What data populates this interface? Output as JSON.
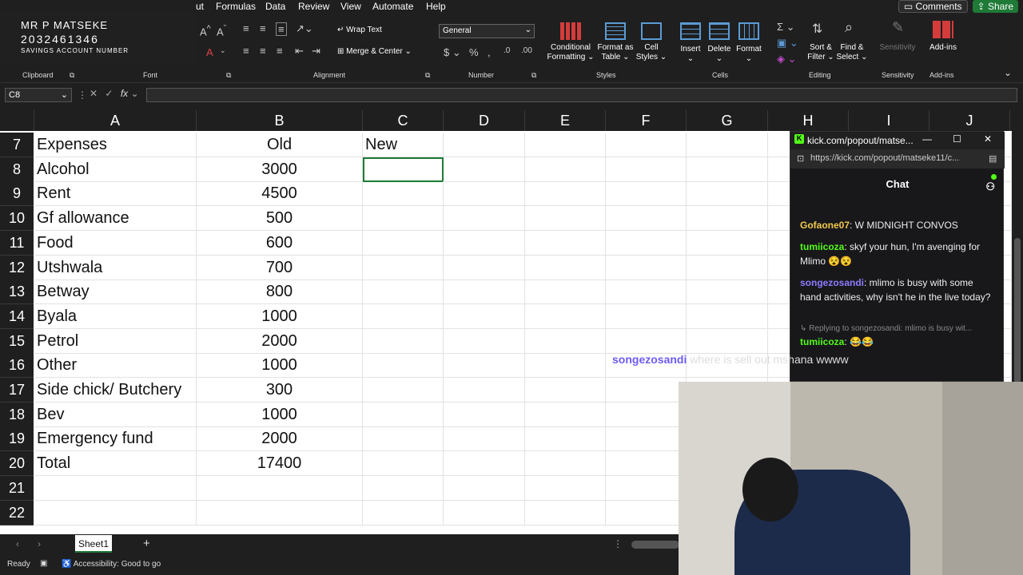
{
  "menu": {
    "tabs": [
      "ut",
      "Formulas",
      "Data",
      "Review",
      "View",
      "Automate",
      "Help"
    ],
    "comments_label": "Comments",
    "share_label": "Share"
  },
  "overlay": {
    "name": "MR P MATSEKE",
    "number": "2032461346",
    "label": "SAVINGS ACCOUNT NUMBER"
  },
  "ribbon": {
    "groups": {
      "clipboard": "Clipboard",
      "font": "Font",
      "alignment": "Alignment",
      "number": "Number",
      "styles": "Styles",
      "cells": "Cells",
      "editing": "Editing",
      "sensitivity": "Sensitivity",
      "addins": "Add-ins"
    },
    "wrap_text": "Wrap Text",
    "merge_center": "Merge & Center",
    "number_format": "General",
    "conditional_formatting": "Conditional Formatting",
    "format_as_table": "Format as Table",
    "cell_styles": "Cell Styles",
    "insert": "Insert",
    "delete": "Delete",
    "format": "Format",
    "sort_filter": "Sort & Filter",
    "find_select": "Find & Select",
    "sensitivity_btn": "Sensitivity",
    "addins_btn": "Add-ins"
  },
  "formula_bar": {
    "name_box": "C8",
    "fx": "fx",
    "value": ""
  },
  "grid": {
    "columns": [
      "A",
      "B",
      "C",
      "D",
      "E",
      "F",
      "G",
      "H",
      "I",
      "J"
    ],
    "rows": [
      {
        "num": "7",
        "a": "Expenses",
        "b": "Old",
        "c": "New"
      },
      {
        "num": "8",
        "a": "Alcohol",
        "b": "3000",
        "c": ""
      },
      {
        "num": "9",
        "a": "Rent",
        "b": "4500",
        "c": ""
      },
      {
        "num": "10",
        "a": "Gf allowance",
        "b": "500",
        "c": ""
      },
      {
        "num": "11",
        "a": "Food",
        "b": "600",
        "c": ""
      },
      {
        "num": "12",
        "a": "Utshwala",
        "b": "700",
        "c": ""
      },
      {
        "num": "13",
        "a": "Betway",
        "b": "800",
        "c": ""
      },
      {
        "num": "14",
        "a": "Byala",
        "b": "1000",
        "c": ""
      },
      {
        "num": "15",
        "a": "Petrol",
        "b": "2000",
        "c": ""
      },
      {
        "num": "16",
        "a": "Other",
        "b": "1000",
        "c": ""
      },
      {
        "num": "17",
        "a": "Side chick/ Butchery",
        "b": "300",
        "c": ""
      },
      {
        "num": "18",
        "a": "Bev",
        "b": "1000",
        "c": ""
      },
      {
        "num": "19",
        "a": "Emergency fund",
        "b": "2000",
        "c": ""
      },
      {
        "num": "20",
        "a": "Total",
        "b": "17400",
        "c": ""
      },
      {
        "num": "21",
        "a": "",
        "b": "",
        "c": ""
      },
      {
        "num": "22",
        "a": "",
        "b": "",
        "c": ""
      }
    ]
  },
  "sheets": {
    "active": "Sheet1",
    "add": "+"
  },
  "status": {
    "ready": "Ready",
    "accessibility": "Accessibility: Good to go"
  },
  "chat": {
    "window_title": "kick.com/popout/matse...",
    "url": "https://kick.com/popout/matseke11/c...",
    "header": "Chat",
    "messages": [
      {
        "user": "Gofaone07",
        "text": ": W MIDNIGHT CONVOS",
        "color": "#f2c94c"
      },
      {
        "user": "tumiicoza",
        "text": ": skyf your hun, I'm avenging for Mlimo",
        "color": "#53fc18"
      },
      {
        "user": "songezosandi",
        "text": ": mlimo is busy with some hand activities, why isn't he in the live today?",
        "color": "#8b7cff"
      },
      {
        "user": "",
        "text": "Replying to songezosandi: mlimo is busy wit...",
        "color": "#888888"
      },
      {
        "user": "tumiicoza",
        "text": ": 😂😂",
        "color": "#53fc18"
      }
    ]
  },
  "caption": {
    "user": "songezosandi",
    "text": "where is sell out mshana wwww"
  }
}
